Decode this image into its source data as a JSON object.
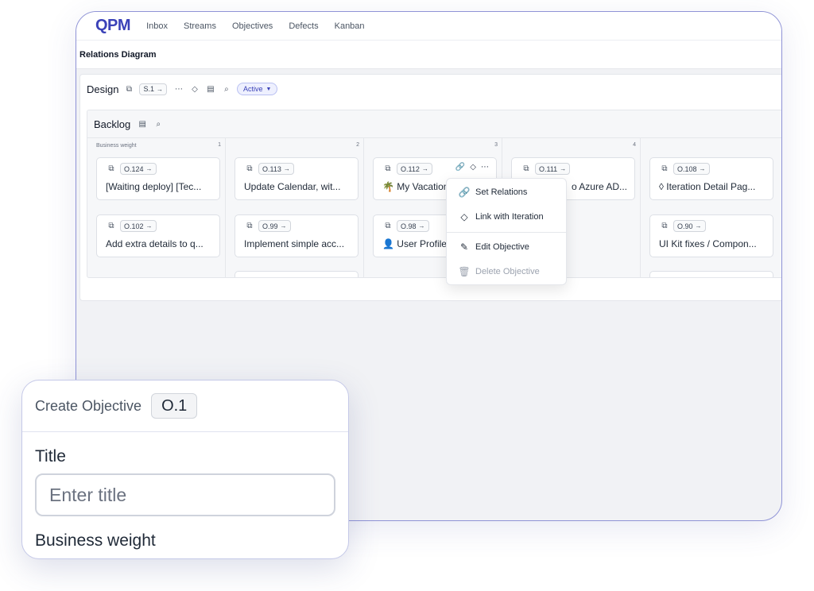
{
  "app": {
    "logo": "QPM",
    "nav": [
      "Inbox",
      "Streams",
      "Objectives",
      "Defects",
      "Kanban"
    ],
    "breadcrumb": "Relations Diagram"
  },
  "design": {
    "title": "Design",
    "chip": "S.1",
    "status": "Active"
  },
  "backlog": {
    "title": "Backlog",
    "column_label": "Business weight",
    "columns": [
      "1",
      "2",
      "3",
      "4"
    ],
    "cards": [
      {
        "id": "O.124",
        "title": "[Waiting deploy] [Tec..."
      },
      {
        "id": "O.113",
        "title": "Update Calendar, wit..."
      },
      {
        "id": "O.112",
        "title": "🌴 My Vacation"
      },
      {
        "id": "O.111",
        "title": "o Azure AD..."
      },
      {
        "id": "O.108",
        "title": "◊ Iteration Detail Pag..."
      },
      {
        "id": "O.102",
        "title": "Add extra details to q..."
      },
      {
        "id": "O.99",
        "title": "Implement simple acc..."
      },
      {
        "id": "O.98",
        "title": "👤 User Profile"
      },
      {
        "id": "O.90",
        "title": "UI Kit fixes / Compon..."
      }
    ]
  },
  "context_menu": {
    "items": [
      "Set Relations",
      "Link with Iteration",
      "Edit Objective",
      "Delete Objective"
    ]
  },
  "create_objective": {
    "title": "Create Objective",
    "id": "O.1",
    "title_label": "Title",
    "title_placeholder": "Enter title",
    "weight_label": "Business weight"
  },
  "icons": {
    "copy": "copy-icon",
    "more": "more-icon",
    "diamond": "diamond-icon",
    "note": "note-icon",
    "search": "search-icon",
    "link": "link-icon",
    "pencil": "pencil-icon",
    "trash": "trash-icon"
  },
  "colors": {
    "brand": "#3b42b8",
    "window_border": "#8f93d6",
    "status_bg": "#eef0fe"
  }
}
